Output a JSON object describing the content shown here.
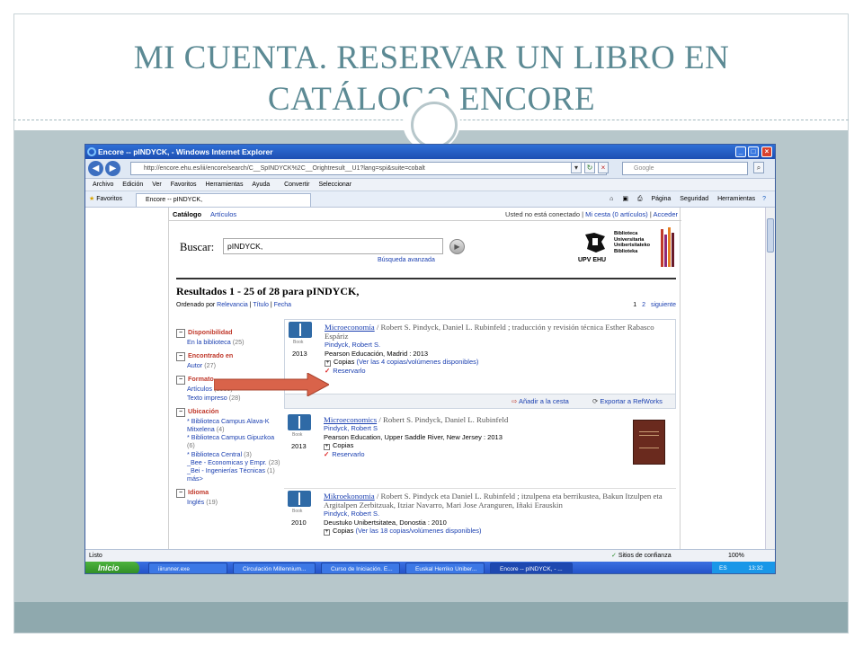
{
  "slide": {
    "title": "MI CUENTA. RESERVAR UN LIBRO EN CATÁLOGO ENCORE"
  },
  "browser": {
    "window_title": "Encore -- pINDYCK, - Windows Internet Explorer",
    "url": "http://encore.ehu.es/iii/encore/search/C__SpINDYCK%2C__Orightresult__U1?lang=spi&suite=cobalt",
    "search_placeholder": "Google",
    "menu": [
      "Archivo",
      "Edición",
      "Ver",
      "Favoritos",
      "Herramientas",
      "Ayuda"
    ],
    "toolbar_extras": [
      "Convertir",
      "Seleccionar"
    ],
    "favorites_label": "Favoritos",
    "tab_label": "Encore -- pINDYCK,",
    "command_bar": [
      "Página",
      "Seguridad",
      "Herramientas"
    ],
    "status_left": "Listo",
    "status_zone": "Sitios de confianza",
    "zoom": "100%"
  },
  "encore": {
    "nav": {
      "catalogo": "Catálogo",
      "articulos": "Artículos",
      "not_connected": "Usted no está conectado",
      "sep": "|",
      "my_basket": "Mi cesta (0 artículos)",
      "access": "Acceder"
    },
    "search": {
      "label": "Buscar:",
      "value": "pINDYCK,",
      "advanced": "Búsqueda avanzada"
    },
    "logo": {
      "line1": "Biblioteca",
      "line2": "Universitaria",
      "line3": "Unibertsitateko",
      "line4": "Biblioteka",
      "org": "UPV EHU"
    },
    "results_heading": "Resultados 1 - 25 of 28 para pINDYCK,",
    "sort": {
      "label": "Ordenado por",
      "relevance": "Relevancia",
      "title": "Título",
      "date": "Fecha"
    },
    "pager": {
      "current": "1",
      "page2": "2",
      "next": "siguiente"
    },
    "facets": [
      {
        "title": "Disponibilidad",
        "items": [
          {
            "label": "En la biblioteca",
            "count": "(25)"
          }
        ]
      },
      {
        "title": "Encontrado en",
        "items": [
          {
            "label": "Autor",
            "count": "(27)"
          }
        ]
      },
      {
        "title": "Formato",
        "items": [
          {
            "label": "Artículos",
            "count": "(3000)"
          },
          {
            "label": "Texto impreso",
            "count": "(28)"
          }
        ]
      },
      {
        "title": "Ubicación",
        "items": [
          {
            "label": "* Biblioteca Campus Alava-K Mitxelena",
            "count": "(4)"
          },
          {
            "label": "* Biblioteca Campus Gipuzkoa",
            "count": "(6)"
          },
          {
            "label": "* Biblioteca Central",
            "count": "(3)"
          },
          {
            "label": "_Bee - Economicas y Empr.",
            "count": "(23)"
          },
          {
            "label": "_Bei - Ingenierías Técnicas",
            "count": "(1)"
          },
          {
            "label": "más>",
            "count": ""
          }
        ]
      },
      {
        "title": "Idioma",
        "items": [
          {
            "label": "Inglés",
            "count": "(19)"
          }
        ]
      }
    ],
    "results": [
      {
        "book_label": "Book",
        "year": "2013",
        "title": "Microeconomía",
        "resp": " / Robert S. Pindyck, Daniel L. Rubinfeld ; traducción y revisión técnica Esther Rabasco Espáriz",
        "author": "Pindyck, Robert S.",
        "publisher": "Pearson Educación, Madrid : 2013",
        "copies_label": "Copias",
        "copies_link": "(Ver las 4 copias/volúmenes disponibles)",
        "reserve": "Reservarlo",
        "add_basket": "Añadir a la cesta",
        "export": "Exportar a RefWorks"
      },
      {
        "book_label": "Book",
        "year": "2013",
        "title": "Microeconomics",
        "resp": " / Robert S. Pindyck, Daniel L. Rubinfeld",
        "author": "Pindyck, Robert S",
        "publisher": "Pearson Education, Upper Saddle River, New Jersey : 2013",
        "copies_label": "Copias",
        "reserve": "Reservarlo"
      },
      {
        "book_label": "Book",
        "year": "2010",
        "title": "Mikroekonomia",
        "resp": " / Robert S. Pindyck eta Daniel L. Rubinfeld ; itzulpena eta berrikustea, Bakun Itzulpen eta Argitalpen Zerbitzuak, Itziar Navarro, Mari Jose Aranguren, Iñaki Erauskin",
        "author": "Pindyck, Robert S.",
        "publisher": "Deustuko Unibertsitatea, Donostia : 2010",
        "copies_label": "Copias",
        "copies_link": "(Ver las 18 copias/volúmenes disponibles)"
      }
    ]
  },
  "taskbar": {
    "start": "Inicio",
    "tasks": [
      "iiirunner.exe",
      "Circulación Millennium...",
      "Curso de Iniciación. E...",
      "Euskal Herriko Uniber...",
      "Encore -- pINDYCK, - ..."
    ],
    "lang": "ES",
    "clock": "13:32"
  },
  "colors": {
    "accent_title": "#5c8a94",
    "slide_band": "#b7c7cb",
    "arrow": "#d9634a",
    "link": "#1a3fb0",
    "facet_title": "#c0392b"
  }
}
